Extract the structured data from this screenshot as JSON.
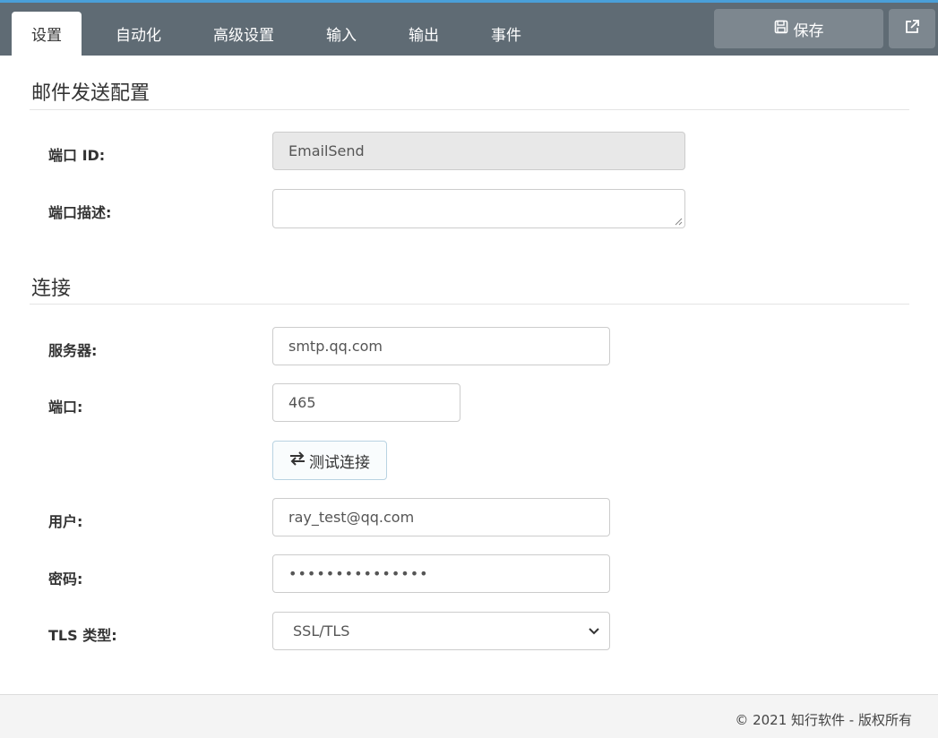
{
  "tabs": [
    {
      "label": "设置",
      "active": true
    },
    {
      "label": "自动化",
      "active": false
    },
    {
      "label": "高级设置",
      "active": false
    },
    {
      "label": "输入",
      "active": false
    },
    {
      "label": "输出",
      "active": false
    },
    {
      "label": "事件",
      "active": false
    }
  ],
  "toolbar": {
    "save_label": "保存",
    "save_icon": "floppy-disk-icon",
    "external_icon": "external-link-icon"
  },
  "sections": {
    "email": {
      "title": "邮件发送配置"
    },
    "connection": {
      "title": "连接"
    }
  },
  "fields": {
    "port_id": {
      "label": "端口 ID:",
      "value": "EmailSend"
    },
    "port_desc": {
      "label": "端口描述:",
      "value": ""
    },
    "server": {
      "label": "服务器:",
      "value": "smtp.qq.com"
    },
    "port": {
      "label": "端口:",
      "value": "465"
    },
    "user": {
      "label": "用户:",
      "value": "ray_test@qq.com"
    },
    "password": {
      "label": "密码:",
      "value": "•••••••••••••••"
    },
    "tls": {
      "label": "TLS 类型:",
      "value": "SSL/TLS"
    }
  },
  "test_button": {
    "label": "测试连接",
    "icon": "exchange-arrows-icon"
  },
  "footer": {
    "text": "© 2021 知行软件 - 版权所有"
  },
  "colors": {
    "topbar": "#5f6b74",
    "button": "#7d878f",
    "accent": "#4a9fd8"
  }
}
